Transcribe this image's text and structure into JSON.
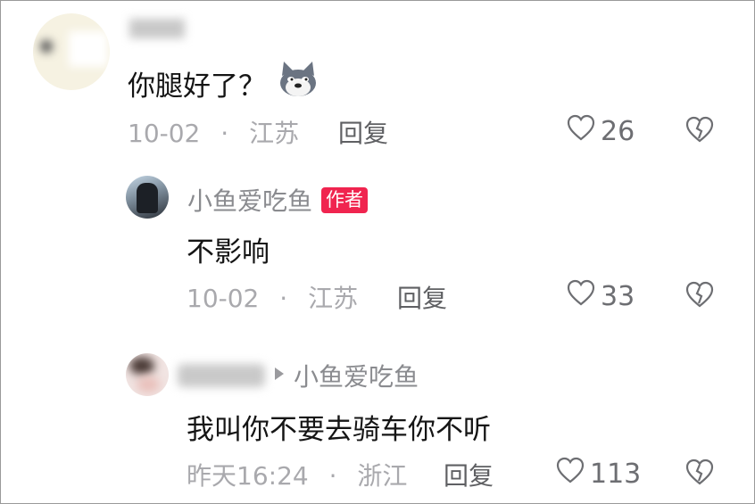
{
  "comments": [
    {
      "username": "",
      "content": "你腿好了？",
      "date": "10-02",
      "location": "江苏",
      "reply_label": "回复",
      "likes": "26",
      "emoji": "husky-dog-emoji"
    },
    {
      "username": "小鱼爱吃鱼",
      "author_badge": "作者",
      "content": "不影响",
      "date": "10-02",
      "location": "江苏",
      "reply_label": "回复",
      "likes": "33"
    },
    {
      "username": "",
      "reply_to": "小鱼爱吃鱼",
      "content": "我叫你不要去骑车你不听",
      "date": "昨天16:24",
      "location": "浙江",
      "reply_label": "回复",
      "likes": "113"
    }
  ],
  "separator": "·",
  "colors": {
    "badge": "#f0244f",
    "meta": "#a9a9ad",
    "text": "#151515"
  }
}
